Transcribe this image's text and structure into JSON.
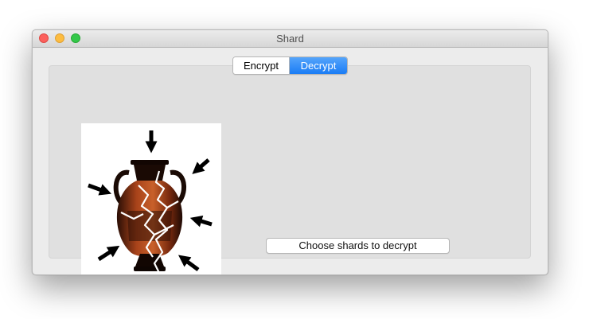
{
  "window": {
    "title": "Shard"
  },
  "tabs": {
    "encrypt_label": "Encrypt",
    "decrypt_label": "Decrypt",
    "selected": "Decrypt"
  },
  "main": {
    "image_icon": "shattered-vase-icon",
    "choose_button_label": "Choose shards to decrypt"
  },
  "colors": {
    "selected_tab": "#1a7cf5",
    "close": "#fc605c",
    "minimize": "#fdbc40",
    "zoom": "#34c84a"
  }
}
